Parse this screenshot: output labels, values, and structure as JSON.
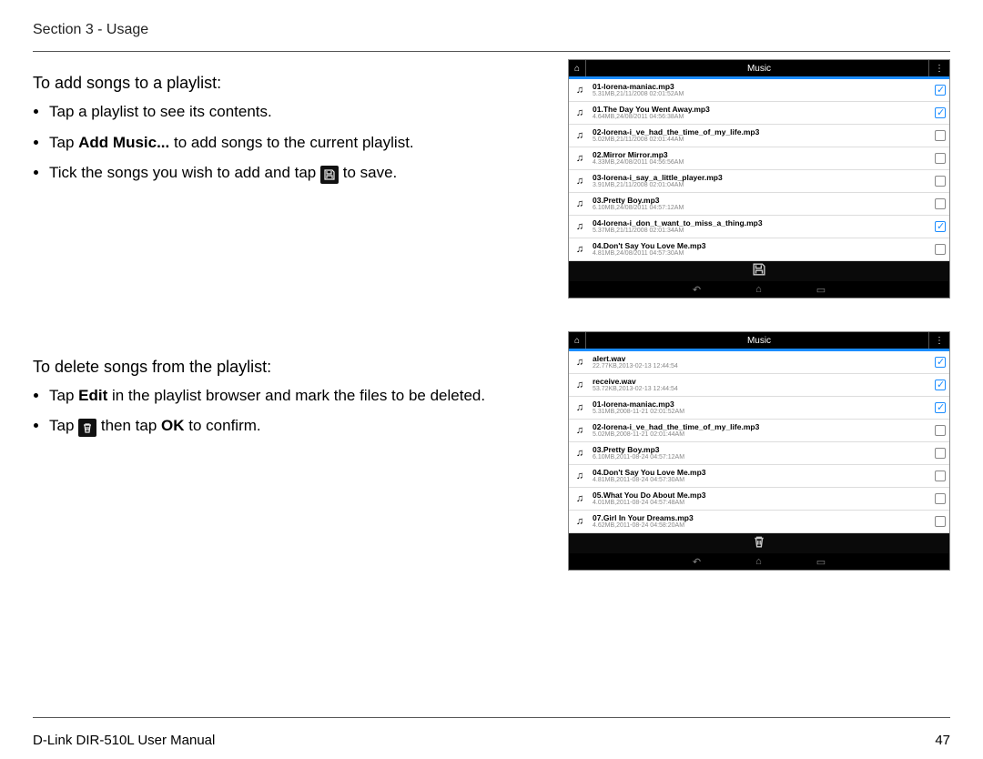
{
  "header": {
    "section": "Section 3 - Usage"
  },
  "sec1": {
    "intro": "To add songs to a playlist:",
    "b1": "Tap a playlist to see its contents.",
    "b2_a": "Tap ",
    "b2_b": "Add Music...",
    "b2_c": " to add songs to the current playlist.",
    "b3_a": "Tick the songs you wish to add and tap ",
    "b3_b": " to save."
  },
  "sec2": {
    "intro": "To delete songs from the playlist:",
    "b1_a": "Tap ",
    "b1_b": "Edit",
    "b1_c": " in the playlist browser and mark the files to be deleted.",
    "b2_a": "Tap ",
    "b2_b": " then tap ",
    "b2_c": "OK",
    "b2_d": "  to confirm."
  },
  "phone": {
    "title": "Music"
  },
  "phone1": {
    "rows": [
      {
        "t": "01-lorena-maniac.mp3",
        "m": "5.31MB,21/11/2008 02:01:52AM",
        "c": true
      },
      {
        "t": "01.The Day You Went Away.mp3",
        "m": "4.64MB,24/08/2011 04:56:38AM",
        "c": true
      },
      {
        "t": "02-lorena-i_ve_had_the_time_of_my_life.mp3",
        "m": "5.02MB,21/11/2008 02:01:44AM",
        "c": false
      },
      {
        "t": "02.Mirror Mirror.mp3",
        "m": "4.33MB,24/08/2011 04:56:56AM",
        "c": false
      },
      {
        "t": "03-lorena-i_say_a_little_player.mp3",
        "m": "3.91MB,21/11/2008 02:01:04AM",
        "c": false
      },
      {
        "t": "03.Pretty Boy.mp3",
        "m": "6.10MB,24/08/2011 04:57:12AM",
        "c": false
      },
      {
        "t": "04-lorena-i_don_t_want_to_miss_a_thing.mp3",
        "m": "5.37MB,21/11/2008 02:01:34AM",
        "c": true
      },
      {
        "t": "04.Don't Say You Love Me.mp3",
        "m": "4.81MB,24/08/2011 04:57:30AM",
        "c": false
      }
    ]
  },
  "phone2": {
    "rows": [
      {
        "t": "alert.wav",
        "m": "22.77KB,2013-02-13 12:44:54",
        "c": true
      },
      {
        "t": "receive.wav",
        "m": "53.72KB,2013-02-13 12:44:54",
        "c": true
      },
      {
        "t": "01-lorena-maniac.mp3",
        "m": "5.31MB,2008-11-21 02:01:52AM",
        "c": true
      },
      {
        "t": "02-lorena-i_ve_had_the_time_of_my_life.mp3",
        "m": "5.02MB,2008-11-21 02:01:44AM",
        "c": false
      },
      {
        "t": "03.Pretty Boy.mp3",
        "m": "6.10MB,2011-08-24 04:57:12AM",
        "c": false
      },
      {
        "t": "04.Don't Say You Love Me.mp3",
        "m": "4.81MB,2011-08-24 04:57:30AM",
        "c": false
      },
      {
        "t": "05.What You Do About Me.mp3",
        "m": "4.01MB,2011-08-24 04:57:48AM",
        "c": false
      },
      {
        "t": "07.Girl In Your Dreams.mp3",
        "m": "4.62MB,2011-08-24 04:58:20AM",
        "c": false
      }
    ]
  },
  "footer": {
    "left": "D-Link DIR-510L User Manual",
    "right": "47"
  }
}
